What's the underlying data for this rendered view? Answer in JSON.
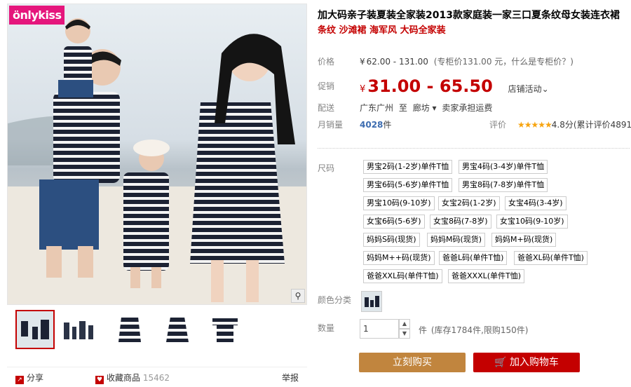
{
  "brand": {
    "logo_text": "önlykiss",
    "accent": "#e5167c"
  },
  "gallery": {
    "zoom_icon": "magnifier-icon",
    "thumbnails": [
      "thumb-1",
      "thumb-2",
      "thumb-3",
      "thumb-4",
      "thumb-5"
    ],
    "share_label": "分享",
    "favorite_label": "收藏商品",
    "favorite_count": "15462",
    "report_label": "举报"
  },
  "product": {
    "title": "加大码亲子装夏装全家装2013款家庭装一家三口夏条纹母女装连衣裙",
    "subtitle": "条纹 沙滩裙 海军风 大码全家装",
    "price_label": "价格",
    "price_currency": "¥",
    "price_range": "62.00 - 131.00",
    "price_note": "(专柜价131.00 元，什么是专柜价？)",
    "promo_label": "促销",
    "promo_currency": "¥",
    "promo_price": "31.00 - 65.50",
    "promo_event": "店铺活动",
    "shipping_label": "配送",
    "shipping_from": "广东广州",
    "shipping_to_word": "至",
    "shipping_dest": "廊坊",
    "shipping_fee": "卖家承担运费",
    "sales_label": "月销量",
    "sales_count": "4028",
    "sales_unit": "件",
    "rating_label": "评价",
    "rating_stars": "★★★★★",
    "rating_score": "4.8分",
    "rating_count": "(累计评价4891)",
    "size_label": "尺码",
    "sizes": [
      "男宝2码(1-2岁)单件T恤",
      "男宝4码(3-4岁)单件T恤",
      "男宝6码(5-6岁)单件T恤",
      "男宝8码(7-8岁)单件T恤",
      "男宝10码(9-10岁)",
      "女宝2码(1-2岁)",
      "女宝4码(3-4岁)",
      "女宝6码(5-6岁)",
      "女宝8码(7-8岁)",
      "女宝10码(9-10岁)",
      "妈妈S码(现货)",
      "妈妈M码(现货)",
      "妈妈M+码(现货)",
      "妈妈M++码(现货)",
      "爸爸L码(单件T恤)",
      "爸爸XL码(单件T恤)",
      "爸爸XXL码(单件T恤)",
      "爸爸XXXL(单件T恤)"
    ],
    "color_label": "颜色分类",
    "qty_label": "数量",
    "qty_value": "1",
    "qty_unit": "件",
    "stock_note": "(库存1784件,限购150件)",
    "buy_now": "立刻购买",
    "add_to_cart": "加入购物车",
    "cart_icon": "cart-icon"
  }
}
